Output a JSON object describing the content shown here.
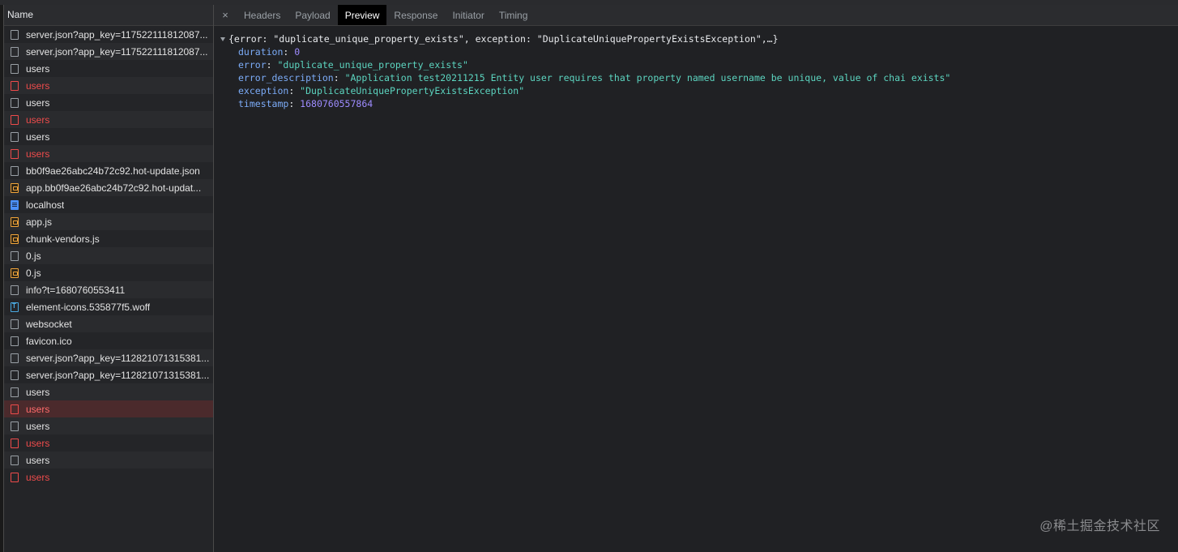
{
  "name_column_header": "Name",
  "requests": [
    {
      "name": "server.json?app_key=117522111812087...",
      "icon": "blank",
      "status": "normal"
    },
    {
      "name": "server.json?app_key=117522111812087...",
      "icon": "blank",
      "status": "normal"
    },
    {
      "name": "users",
      "icon": "blank",
      "status": "normal"
    },
    {
      "name": "users",
      "icon": "blank",
      "status": "error"
    },
    {
      "name": "users",
      "icon": "blank",
      "status": "normal"
    },
    {
      "name": "users",
      "icon": "blank",
      "status": "error"
    },
    {
      "name": "users",
      "icon": "blank",
      "status": "normal"
    },
    {
      "name": "users",
      "icon": "blank",
      "status": "error"
    },
    {
      "name": "bb0f9ae26abc24b72c92.hot-update.json",
      "icon": "blank",
      "status": "normal"
    },
    {
      "name": "app.bb0f9ae26abc24b72c92.hot-updat...",
      "icon": "script",
      "status": "normal"
    },
    {
      "name": "localhost",
      "icon": "document",
      "status": "normal"
    },
    {
      "name": "app.js",
      "icon": "script",
      "status": "normal"
    },
    {
      "name": "chunk-vendors.js",
      "icon": "script",
      "status": "normal"
    },
    {
      "name": "0.js",
      "icon": "blank",
      "status": "normal"
    },
    {
      "name": "0.js",
      "icon": "script",
      "status": "normal"
    },
    {
      "name": "info?t=1680760553411",
      "icon": "blank",
      "status": "normal"
    },
    {
      "name": "element-icons.535877f5.woff",
      "icon": "font",
      "status": "normal"
    },
    {
      "name": "websocket",
      "icon": "blank",
      "status": "normal"
    },
    {
      "name": "favicon.ico",
      "icon": "blank",
      "status": "normal"
    },
    {
      "name": "server.json?app_key=112821071315381...",
      "icon": "blank",
      "status": "normal"
    },
    {
      "name": "server.json?app_key=112821071315381...",
      "icon": "blank",
      "status": "normal"
    },
    {
      "name": "users",
      "icon": "blank",
      "status": "normal"
    },
    {
      "name": "users",
      "icon": "blank",
      "status": "selected"
    },
    {
      "name": "users",
      "icon": "blank",
      "status": "normal"
    },
    {
      "name": "users",
      "icon": "blank",
      "status": "error"
    },
    {
      "name": "users",
      "icon": "blank",
      "status": "normal"
    },
    {
      "name": "users",
      "icon": "blank",
      "status": "error"
    }
  ],
  "detail_tabs": {
    "close_glyph": "×",
    "headers": "Headers",
    "payload": "Payload",
    "preview": "Preview",
    "response": "Response",
    "initiator": "Initiator",
    "timing": "Timing",
    "active": "Preview"
  },
  "preview": {
    "summary": "{error: \"duplicate_unique_property_exists\", exception: \"DuplicateUniquePropertyExistsException\",…}",
    "properties": [
      {
        "key": "duration",
        "value": "0",
        "type": "number"
      },
      {
        "key": "error",
        "value": "\"duplicate_unique_property_exists\"",
        "type": "string"
      },
      {
        "key": "error_description",
        "value": "\"Application test20211215 Entity user requires that property named username be unique, value of chai exists\"",
        "type": "string"
      },
      {
        "key": "exception",
        "value": "\"DuplicateUniquePropertyExistsException\"",
        "type": "string"
      },
      {
        "key": "timestamp",
        "value": "1680760557864",
        "type": "number"
      }
    ]
  },
  "watermark": "@稀土掘金技术社区",
  "colors": {
    "error_text": "#ee4b4b",
    "selected_row_bg": "#4b2a2c",
    "key": "#7cacf8",
    "string": "#5cd5c0",
    "number": "#9e8cff",
    "active_tab_bg": "#000000"
  }
}
